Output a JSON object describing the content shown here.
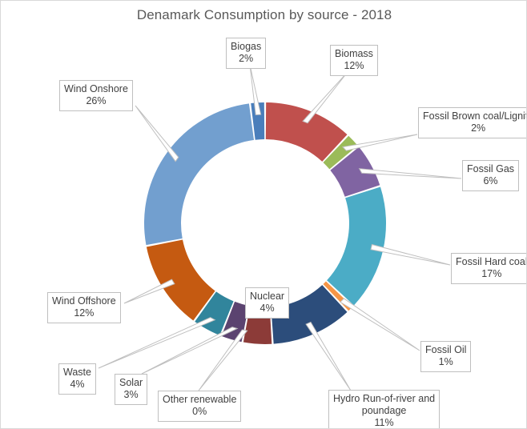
{
  "chart": {
    "title": "Denamark Consumption by source - 2018",
    "frame_border_color": "#d9d9d9",
    "title_color": "#595959",
    "label_text_color": "#404040",
    "label_border_color": "#bfbfbf",
    "leader_line_color": "#bfbfbf"
  },
  "chart_data": {
    "type": "pie",
    "variant": "doughnut",
    "title": "Denamark Consumption by source - 2018",
    "xlabel": "",
    "ylabel": "",
    "legend_position": "none",
    "data_labels": "category name + percentage, outside end, with leader lines",
    "grid": false,
    "categories": [
      "Biomass",
      "Fossil Brown coal/Lignite",
      "Fossil Gas",
      "Fossil Hard coal",
      "Fossil Oil",
      "Hydro Run-of-river and poundage",
      "Nuclear",
      "Other renewable",
      "Solar",
      "Waste",
      "Wind Offshore",
      "Wind Onshore",
      "Biogas"
    ],
    "values": [
      12,
      2,
      6,
      17,
      1,
      11,
      4,
      0,
      3,
      4,
      12,
      26,
      2
    ],
    "value_labels": [
      "12%",
      "2%",
      "6%",
      "17%",
      "1%",
      "11%",
      "4%",
      "0%",
      "3%",
      "4%",
      "12%",
      "26%",
      "2%"
    ],
    "colors": [
      "#C0504D",
      "#9BBB59",
      "#8064A2",
      "#4BACC6",
      "#F79646",
      "#2C4D7B",
      "#8C3B38",
      "#4F6228",
      "#5B4370",
      "#31859C",
      "#C55A11",
      "#729FCF",
      "#4A7EBB"
    ],
    "units": "percent of consumption"
  },
  "labels": [
    {
      "id": "biogas",
      "category": "Biogas",
      "percent": "2%"
    },
    {
      "id": "biomass",
      "category": "Biomass",
      "percent": "12%"
    },
    {
      "id": "brown-coal",
      "category": "Fossil Brown coal/Lignite",
      "percent": "2%"
    },
    {
      "id": "fossil-gas",
      "category": "Fossil Gas",
      "percent": "6%"
    },
    {
      "id": "hard-coal",
      "category": "Fossil Hard coal",
      "percent": "17%"
    },
    {
      "id": "fossil-oil",
      "category": "Fossil Oil",
      "percent": "1%"
    },
    {
      "id": "hydro",
      "category": "Hydro Run-of-river and",
      "category2": "poundage",
      "percent": "11%"
    },
    {
      "id": "nuclear",
      "category": "Nuclear",
      "percent": "4%"
    },
    {
      "id": "other-renew",
      "category": "Other renewable",
      "percent": "0%"
    },
    {
      "id": "solar",
      "category": "Solar",
      "percent": "3%"
    },
    {
      "id": "waste",
      "category": "Waste",
      "percent": "4%"
    },
    {
      "id": "wind-offshore",
      "category": "Wind Offshore",
      "percent": "12%"
    },
    {
      "id": "wind-onshore",
      "category": "Wind Onshore",
      "percent": "26%"
    }
  ]
}
